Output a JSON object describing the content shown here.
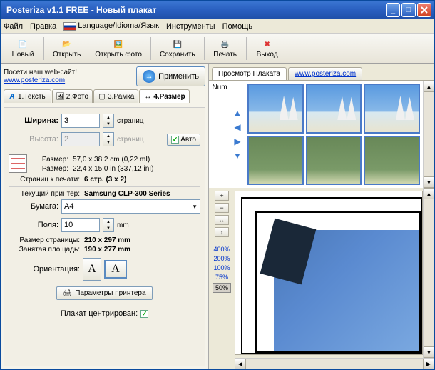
{
  "window": {
    "title": "Posteriza v1.1 FREE - Новый плакат"
  },
  "menu": {
    "file": "Файл",
    "edit": "Правка",
    "lang": "Language/Idioma/Язык",
    "tools": "Инструменты",
    "help": "Помощь"
  },
  "toolbar": {
    "new": "Новый",
    "open": "Открыть",
    "openphoto": "Открыть фото",
    "save": "Сохранить",
    "print": "Печать",
    "exit": "Выход"
  },
  "visit": {
    "msg": "Посети наш web-сайт!",
    "url": "www.posteriza.com",
    "apply": "Применить"
  },
  "tabs": {
    "t1": "1.Тексты",
    "t2": "2.Фото",
    "t3": "3.Рамка",
    "t4": "4.Размер"
  },
  "size": {
    "width_label": "Ширина:",
    "width_value": "3",
    "height_label": "Высота:",
    "height_value": "2",
    "unit": "страниц",
    "auto": "Авто",
    "dim_label": "Размер:",
    "dim_cm": "57,0 x 38,2 cm (0,22 mI)",
    "dim_in": "22,4 x 15,0 in (337,12 inI)",
    "pages_label": "Страниц к печати:",
    "pages_value": "6 стр. (3 x 2)"
  },
  "printer": {
    "current_label": "Текущий принтер:",
    "current_value": "Samsung CLP-300 Series",
    "paper_label": "Бумага:",
    "paper_value": "A4",
    "margins_label": "Поля:",
    "margins_value": "10",
    "margins_unit": "mm",
    "pagesize_label": "Размер страницы:",
    "pagesize_value": "210 x 297 mm",
    "usedarea_label": "Занятая площадь:",
    "usedarea_value": "190 x 277 mm",
    "orientation_label": "Ориентация:",
    "params_btn": "Параметры принтера"
  },
  "center": {
    "label": "Плакат центрирован:"
  },
  "preview": {
    "tab1": "Просмотр Плаката",
    "tab2": "www.posteriza.com",
    "num": "Num"
  },
  "zoom": {
    "z400": "400%",
    "z200": "200%",
    "z100": "100%",
    "z75": "75%",
    "z50": "50%"
  }
}
